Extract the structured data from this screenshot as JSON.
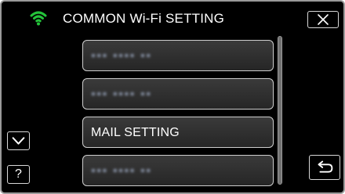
{
  "header": {
    "title": "COMMON Wi-Fi SETTING",
    "wifi_icon": "wifi-icon",
    "wifi_color": "#24c33a",
    "close_icon": "close-icon"
  },
  "menu": {
    "items": [
      {
        "label": "▪▪▪ ▪▪▪▪ ▪▪",
        "obscured": true
      },
      {
        "label": "▪▪▪ ▪▪▪▪ ▪▪",
        "obscured": true
      },
      {
        "label": "MAIL SETTING",
        "obscured": false
      },
      {
        "label": "▪▪▪ ▪▪▪▪ ▪▪",
        "obscured": true
      }
    ]
  },
  "nav": {
    "scroll_down_icon": "chevron-down-icon",
    "help_label": "?",
    "back_icon": "return-icon"
  },
  "colors": {
    "background": "#000000",
    "frame": "#9a9a9a",
    "button_border": "#d8d8d8",
    "wifi_green": "#24c33a"
  }
}
